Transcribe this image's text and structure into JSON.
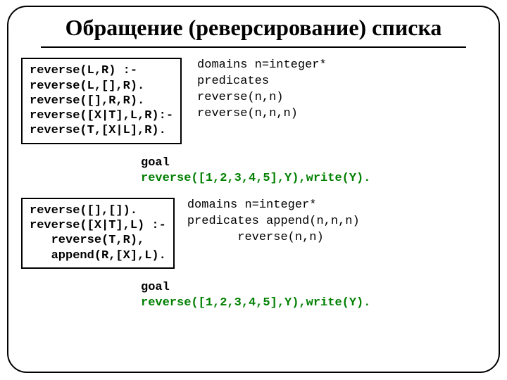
{
  "title": "Обращение (реверсирование) списка",
  "box1": "reverse(L,R) :-\nreverse(L,[],R).\nreverse([],R,R).\nreverse([X|T],L,R):-\nreverse(T,[X|L],R).",
  "decl1": "domains n=integer*\npredicates\nreverse(n,n)\nreverse(n,n,n)",
  "goal1": {
    "label": "goal",
    "code": "reverse([1,2,3,4,5],Y),write(Y)."
  },
  "box2": "reverse([],[]).\nreverse([X|T],L) :-\n   reverse(T,R),\n   append(R,[X],L).",
  "decl2": "domains n=integer*\npredicates append(n,n,n)\n       reverse(n,n)",
  "goal2": {
    "label": "goal",
    "code": "reverse([1,2,3,4,5],Y),write(Y)."
  }
}
